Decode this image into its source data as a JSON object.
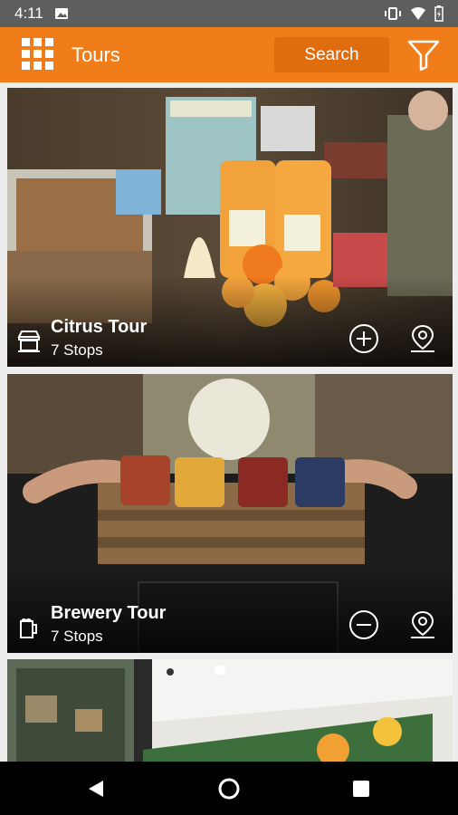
{
  "status": {
    "time": "4:11"
  },
  "app_bar": {
    "title": "Tours",
    "search_label": "Search"
  },
  "tours": [
    {
      "title": "Citrus Tour",
      "stops": "7 Stops",
      "icon": "storefront-icon",
      "action": "add"
    },
    {
      "title": "Brewery Tour",
      "stops": "7 Stops",
      "icon": "beer-mug-icon",
      "action": "remove"
    },
    {
      "title": "",
      "stops": ""
    }
  ],
  "colors": {
    "accent": "#f07d1a",
    "status_bar": "#5e5e5e"
  }
}
